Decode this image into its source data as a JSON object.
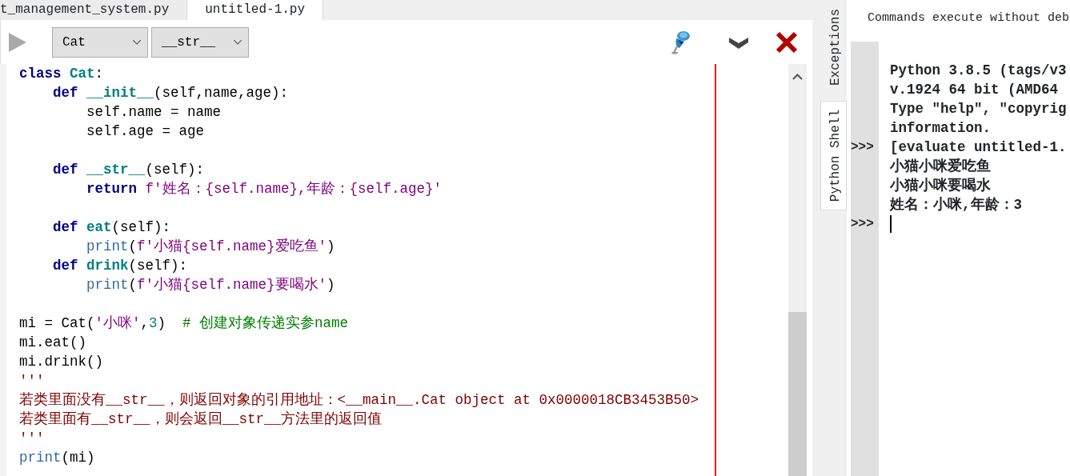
{
  "editor_tabs": [
    {
      "label": "t_management_system.py",
      "selected": false
    },
    {
      "label": "untitled-1.py",
      "selected": true
    }
  ],
  "toolbar": {
    "class_select": "Cat",
    "method_select": "__str__"
  },
  "code_lines": [
    {
      "kind": "code",
      "tokens": [
        {
          "kind": "kw",
          "text": "class "
        },
        {
          "kind": "name",
          "text": "Cat"
        },
        {
          "kind": "plain",
          "text": ":"
        }
      ]
    },
    {
      "kind": "code",
      "tokens": [
        {
          "kind": "kw",
          "text": "    def "
        },
        {
          "kind": "name",
          "text": "__init__"
        },
        {
          "kind": "plain",
          "text": "(self,name,age):"
        }
      ]
    },
    {
      "kind": "code",
      "tokens": [
        {
          "kind": "plain",
          "text": "        self.name = name"
        }
      ]
    },
    {
      "kind": "code",
      "tokens": [
        {
          "kind": "plain",
          "text": "        self.age = age"
        }
      ]
    },
    {
      "kind": "blank"
    },
    {
      "kind": "code",
      "tokens": [
        {
          "kind": "kw",
          "text": "    def "
        },
        {
          "kind": "name",
          "text": "__str__"
        },
        {
          "kind": "plain",
          "text": "(self):"
        }
      ]
    },
    {
      "kind": "code",
      "tokens": [
        {
          "kind": "kw",
          "text": "        return "
        },
        {
          "kind": "str",
          "text": "f'姓名：{self.name},年龄：{self.age}'"
        }
      ]
    },
    {
      "kind": "blank"
    },
    {
      "kind": "code",
      "tokens": [
        {
          "kind": "kw",
          "text": "    def "
        },
        {
          "kind": "name",
          "text": "eat"
        },
        {
          "kind": "plain",
          "text": "(self):"
        }
      ]
    },
    {
      "kind": "code",
      "tokens": [
        {
          "kind": "builtin",
          "text": "        print"
        },
        {
          "kind": "plain",
          "text": "("
        },
        {
          "kind": "str",
          "text": "f'小猫{self.name}爱吃鱼'"
        },
        {
          "kind": "plain",
          "text": ")"
        }
      ]
    },
    {
      "kind": "code",
      "tokens": [
        {
          "kind": "kw",
          "text": "    def "
        },
        {
          "kind": "name",
          "text": "drink"
        },
        {
          "kind": "plain",
          "text": "(self):"
        }
      ]
    },
    {
      "kind": "code",
      "tokens": [
        {
          "kind": "builtin",
          "text": "        print"
        },
        {
          "kind": "plain",
          "text": "("
        },
        {
          "kind": "str",
          "text": "f'小猫{self.name}要喝水'"
        },
        {
          "kind": "plain",
          "text": ")"
        }
      ]
    },
    {
      "kind": "blank"
    },
    {
      "kind": "code",
      "tokens": [
        {
          "kind": "plain",
          "text": "mi = Cat("
        },
        {
          "kind": "str",
          "text": "'小咪'"
        },
        {
          "kind": "plain",
          "text": ","
        },
        {
          "kind": "num",
          "text": "3"
        },
        {
          "kind": "plain",
          "text": ")  "
        },
        {
          "kind": "cmt",
          "text": "# 创建对象传递实参name"
        }
      ]
    },
    {
      "kind": "code",
      "tokens": [
        {
          "kind": "plain",
          "text": "mi.eat()"
        }
      ]
    },
    {
      "kind": "code",
      "tokens": [
        {
          "kind": "plain",
          "text": "mi.drink()"
        }
      ]
    },
    {
      "kind": "code",
      "tokens": [
        {
          "kind": "doc",
          "text": "'''"
        }
      ]
    },
    {
      "kind": "code",
      "tokens": [
        {
          "kind": "doc",
          "text": "若类里面没有__str__，则返回对象的引用地址：<__main__.Cat object at 0x0000018CB3453B50>"
        }
      ]
    },
    {
      "kind": "code",
      "tokens": [
        {
          "kind": "doc",
          "text": "若类里面有__str__，则会返回__str__方法里的返回值"
        }
      ]
    },
    {
      "kind": "code",
      "tokens": [
        {
          "kind": "doc",
          "text": "'''"
        }
      ]
    },
    {
      "kind": "code",
      "tokens": [
        {
          "kind": "builtin",
          "text": "print"
        },
        {
          "kind": "plain",
          "text": "(mi)"
        }
      ]
    }
  ],
  "side_tabs": [
    {
      "label": "Exceptions",
      "selected": false
    },
    {
      "label": "Python Shell",
      "selected": true
    }
  ],
  "shell": {
    "header": "Commands execute without deb",
    "lines": [
      {
        "text": "Python 3.8.5 (tags/v3"
      },
      {
        "text": "v.1924 64 bit (AMD64"
      },
      {
        "text": "Type \"help\", \"copyrig"
      },
      {
        "text": "information."
      },
      {
        "prompt": ">>>",
        "text": "[evaluate untitled-1."
      },
      {
        "text": "小猫小咪爱吃鱼"
      },
      {
        "text": "小猫小咪要喝水"
      },
      {
        "text": "姓名：小咪,年龄：3"
      },
      {
        "prompt": ">>>",
        "cursor": true
      }
    ]
  }
}
